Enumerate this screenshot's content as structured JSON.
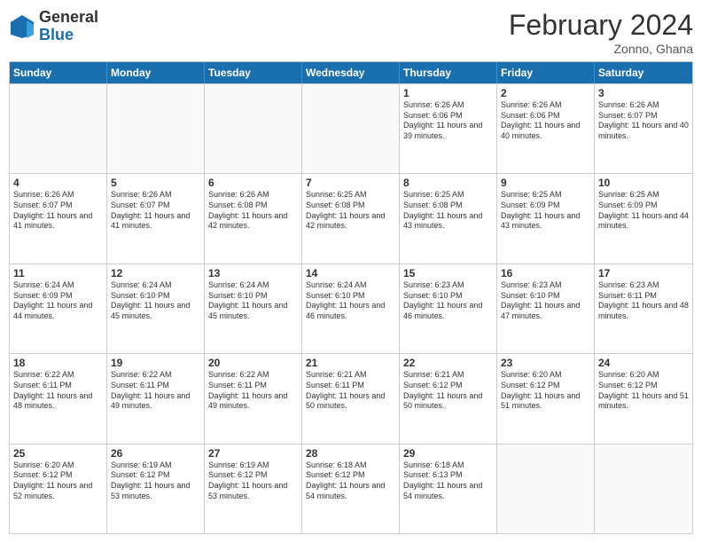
{
  "header": {
    "logo_general": "General",
    "logo_blue": "Blue",
    "title": "February 2024",
    "subtitle": "Zonno, Ghana"
  },
  "days_of_week": [
    "Sunday",
    "Monday",
    "Tuesday",
    "Wednesday",
    "Thursday",
    "Friday",
    "Saturday"
  ],
  "rows": [
    [
      {
        "day": "",
        "info": ""
      },
      {
        "day": "",
        "info": ""
      },
      {
        "day": "",
        "info": ""
      },
      {
        "day": "",
        "info": ""
      },
      {
        "day": "1",
        "info": "Sunrise: 6:26 AM\nSunset: 6:06 PM\nDaylight: 11 hours and 39 minutes."
      },
      {
        "day": "2",
        "info": "Sunrise: 6:26 AM\nSunset: 6:06 PM\nDaylight: 11 hours and 40 minutes."
      },
      {
        "day": "3",
        "info": "Sunrise: 6:26 AM\nSunset: 6:07 PM\nDaylight: 11 hours and 40 minutes."
      }
    ],
    [
      {
        "day": "4",
        "info": "Sunrise: 6:26 AM\nSunset: 6:07 PM\nDaylight: 11 hours and 41 minutes."
      },
      {
        "day": "5",
        "info": "Sunrise: 6:26 AM\nSunset: 6:07 PM\nDaylight: 11 hours and 41 minutes."
      },
      {
        "day": "6",
        "info": "Sunrise: 6:26 AM\nSunset: 6:08 PM\nDaylight: 11 hours and 42 minutes."
      },
      {
        "day": "7",
        "info": "Sunrise: 6:25 AM\nSunset: 6:08 PM\nDaylight: 11 hours and 42 minutes."
      },
      {
        "day": "8",
        "info": "Sunrise: 6:25 AM\nSunset: 6:08 PM\nDaylight: 11 hours and 43 minutes."
      },
      {
        "day": "9",
        "info": "Sunrise: 6:25 AM\nSunset: 6:09 PM\nDaylight: 11 hours and 43 minutes."
      },
      {
        "day": "10",
        "info": "Sunrise: 6:25 AM\nSunset: 6:09 PM\nDaylight: 11 hours and 44 minutes."
      }
    ],
    [
      {
        "day": "11",
        "info": "Sunrise: 6:24 AM\nSunset: 6:09 PM\nDaylight: 11 hours and 44 minutes."
      },
      {
        "day": "12",
        "info": "Sunrise: 6:24 AM\nSunset: 6:10 PM\nDaylight: 11 hours and 45 minutes."
      },
      {
        "day": "13",
        "info": "Sunrise: 6:24 AM\nSunset: 6:10 PM\nDaylight: 11 hours and 45 minutes."
      },
      {
        "day": "14",
        "info": "Sunrise: 6:24 AM\nSunset: 6:10 PM\nDaylight: 11 hours and 46 minutes."
      },
      {
        "day": "15",
        "info": "Sunrise: 6:23 AM\nSunset: 6:10 PM\nDaylight: 11 hours and 46 minutes."
      },
      {
        "day": "16",
        "info": "Sunrise: 6:23 AM\nSunset: 6:10 PM\nDaylight: 11 hours and 47 minutes."
      },
      {
        "day": "17",
        "info": "Sunrise: 6:23 AM\nSunset: 6:11 PM\nDaylight: 11 hours and 48 minutes."
      }
    ],
    [
      {
        "day": "18",
        "info": "Sunrise: 6:22 AM\nSunset: 6:11 PM\nDaylight: 11 hours and 48 minutes."
      },
      {
        "day": "19",
        "info": "Sunrise: 6:22 AM\nSunset: 6:11 PM\nDaylight: 11 hours and 49 minutes."
      },
      {
        "day": "20",
        "info": "Sunrise: 6:22 AM\nSunset: 6:11 PM\nDaylight: 11 hours and 49 minutes."
      },
      {
        "day": "21",
        "info": "Sunrise: 6:21 AM\nSunset: 6:11 PM\nDaylight: 11 hours and 50 minutes."
      },
      {
        "day": "22",
        "info": "Sunrise: 6:21 AM\nSunset: 6:12 PM\nDaylight: 11 hours and 50 minutes."
      },
      {
        "day": "23",
        "info": "Sunrise: 6:20 AM\nSunset: 6:12 PM\nDaylight: 11 hours and 51 minutes."
      },
      {
        "day": "24",
        "info": "Sunrise: 6:20 AM\nSunset: 6:12 PM\nDaylight: 11 hours and 51 minutes."
      }
    ],
    [
      {
        "day": "25",
        "info": "Sunrise: 6:20 AM\nSunset: 6:12 PM\nDaylight: 11 hours and 52 minutes."
      },
      {
        "day": "26",
        "info": "Sunrise: 6:19 AM\nSunset: 6:12 PM\nDaylight: 11 hours and 53 minutes."
      },
      {
        "day": "27",
        "info": "Sunrise: 6:19 AM\nSunset: 6:12 PM\nDaylight: 11 hours and 53 minutes."
      },
      {
        "day": "28",
        "info": "Sunrise: 6:18 AM\nSunset: 6:12 PM\nDaylight: 11 hours and 54 minutes."
      },
      {
        "day": "29",
        "info": "Sunrise: 6:18 AM\nSunset: 6:13 PM\nDaylight: 11 hours and 54 minutes."
      },
      {
        "day": "",
        "info": ""
      },
      {
        "day": "",
        "info": ""
      }
    ]
  ]
}
